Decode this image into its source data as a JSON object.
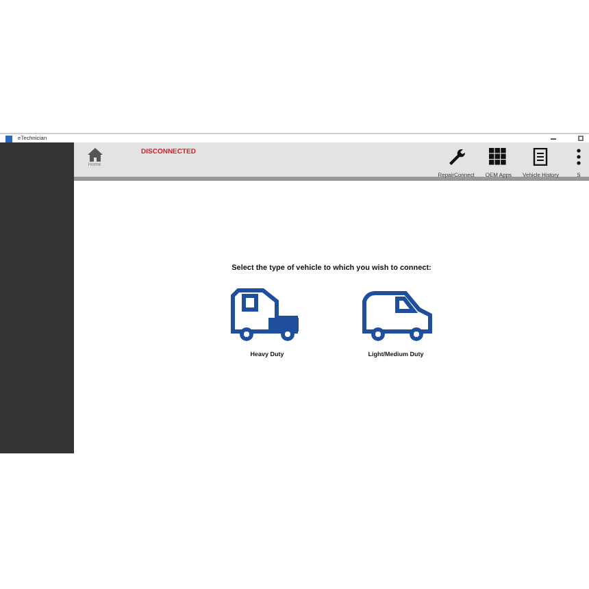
{
  "window": {
    "title": "eTechnician"
  },
  "status": {
    "text": "DISCONNECTED"
  },
  "home": {
    "label": "Home"
  },
  "toolbar": [
    {
      "kind": "wrench",
      "label": "RepairConnect"
    },
    {
      "kind": "grid",
      "label": "OEM Apps"
    },
    {
      "kind": "doc",
      "label": "Vehicle History"
    },
    {
      "kind": "dots",
      "label": "S"
    }
  ],
  "prompt": "Select the type of vehicle to which you wish to connect:",
  "vehicles": [
    {
      "kind": "truck",
      "label": "Heavy Duty"
    },
    {
      "kind": "van",
      "label": "Light/Medium Duty"
    }
  ]
}
